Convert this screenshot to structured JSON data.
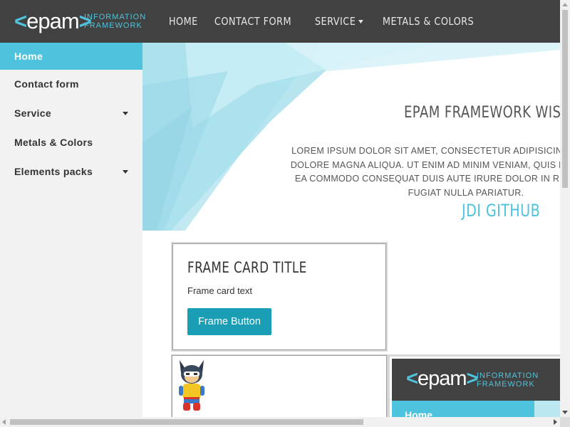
{
  "header": {
    "logo_text": "epam",
    "logo_sub_line1": "INFORMATION",
    "logo_sub_line2": "FRAMEWORK",
    "nav": [
      {
        "label": "HOME"
      },
      {
        "label": "CONTACT FORM"
      },
      {
        "label": "SERVICE"
      },
      {
        "label": "METALS & COLORS"
      }
    ]
  },
  "sidebar": {
    "items": [
      {
        "label": "Home",
        "active": true
      },
      {
        "label": "Contact form"
      },
      {
        "label": "Service",
        "has_submenu": true
      },
      {
        "label": "Metals & Colors"
      },
      {
        "label": "Elements packs",
        "has_submenu": true
      }
    ]
  },
  "hero": {
    "title": "EPAM FRAMEWORK WIS",
    "text_line1": "LOREM IPSUM DOLOR SIT AMET, CONSECTETUR ADIPISICING ELIT, SED DO E",
    "text_line2": "DOLORE MAGNA ALIQUA. UT ENIM AD MINIM VENIAM, QUIS NOSTRUD EXERCI",
    "text_line3": "EA COMMODO CONSEQUAT DUIS AUTE IRURE DOLOR IN REPREHENDERIT I",
    "text_line4": "FUGIAT NULLA PARIATUR.",
    "link": "JDI GITHUB"
  },
  "frame_card": {
    "title": "FRAME CARD TITLE",
    "text": "Frame card text",
    "button": "Frame Button"
  },
  "mini_preview": {
    "logo_text": "epam",
    "logo_sub_line1": "INFORMATION",
    "logo_sub_line2": "FRAMEWORK",
    "home_label": "Home"
  },
  "colors": {
    "header_bg": "#414141",
    "accent": "#4ec3dd",
    "button_bg": "#1a9eb5",
    "sidebar_bg": "#f2f2f2"
  }
}
